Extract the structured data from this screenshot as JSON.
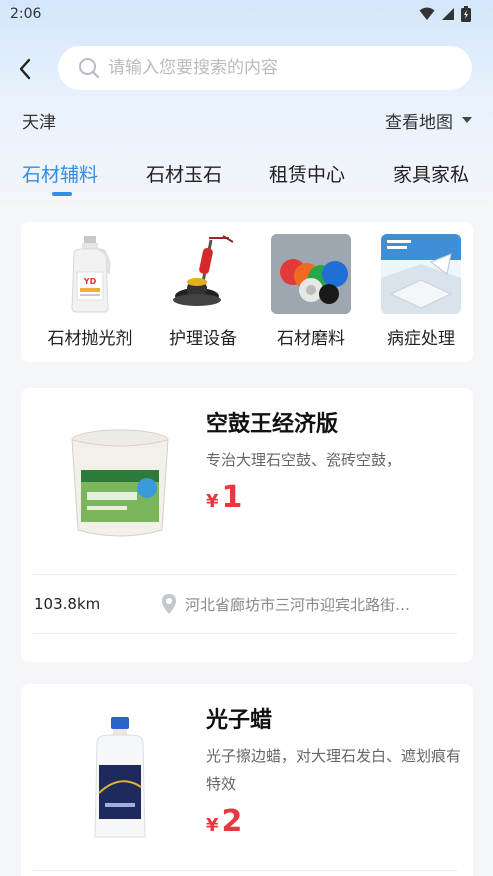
{
  "status_bar": {
    "time": "2:06"
  },
  "search": {
    "placeholder": "请输入您要搜索的内容"
  },
  "location": {
    "city": "天津",
    "map_label": "查看地图"
  },
  "tabs": [
    {
      "label": "石材辅料",
      "active": true
    },
    {
      "label": "石材玉石",
      "active": false
    },
    {
      "label": "租赁中心",
      "active": false
    },
    {
      "label": "家具家私",
      "active": false
    }
  ],
  "categories": [
    {
      "label": "石材抛光剂",
      "icon": "polish-bottle-icon"
    },
    {
      "label": "护理设备",
      "icon": "floor-machine-icon"
    },
    {
      "label": "石材磨料",
      "icon": "abrasive-pads-icon"
    },
    {
      "label": "病症处理",
      "icon": "stone-treatment-icon"
    }
  ],
  "products": [
    {
      "title": "空鼓王经济版",
      "description": "专治大理石空鼓、瓷砖空鼓，",
      "currency": "¥",
      "price": "1",
      "distance": "103.8km",
      "address": "河北省廊坊市三河市迎宾北路街…"
    },
    {
      "title": "光子蜡",
      "description": "光子擦边蜡，对大理石发白、遮划痕有特效",
      "currency": "¥",
      "price": "2"
    }
  ],
  "colors": {
    "accent": "#2f8ee8",
    "price": "#e8383d"
  }
}
